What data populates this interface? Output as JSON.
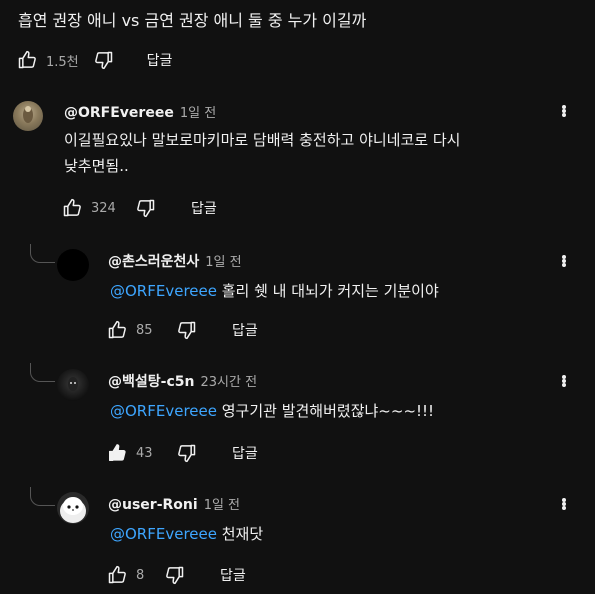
{
  "video_comment": {
    "text": "흡연 권장 애니 vs 금연 권장 애니 둘 중 누가 이길까",
    "likes": "1.5천",
    "reply_label": "답글"
  },
  "comment": {
    "handle": "@ORFEvereee",
    "time": "1일 전",
    "text_line1": "이길필요있나 말보로마키마로 담배력 충전하고 야니네코로 다시",
    "text_line2": "낮추면됨..",
    "likes": "324",
    "reply_label": "답글"
  },
  "replies": [
    {
      "handle": "@촌스러운천사",
      "time": "1일 전",
      "mention": "@ORFEvereee",
      "text": " 홀리 쉣 내 대뇌가 커지는 기분이야",
      "likes": "85",
      "reply_label": "답글"
    },
    {
      "handle": "@백설탕-c5n",
      "time": "23시간 전",
      "mention": "@ORFEvereee",
      "text": " 영구기관 발견해버렸잖냐~~~!!!",
      "likes": "43",
      "reply_label": "답글"
    },
    {
      "handle": "@user-Roni",
      "time": "1일 전",
      "mention": "@ORFEvereee",
      "text": " 천재닷",
      "likes": "8",
      "reply_label": "답글"
    }
  ],
  "icons": {
    "like": "thumbs-up-icon",
    "dislike": "thumbs-down-icon",
    "more": "more-vertical-icon"
  },
  "colors": {
    "background": "#111111",
    "mention": "#3ea6ff",
    "text": "#f1f1f1",
    "muted": "#aaaaaa"
  }
}
